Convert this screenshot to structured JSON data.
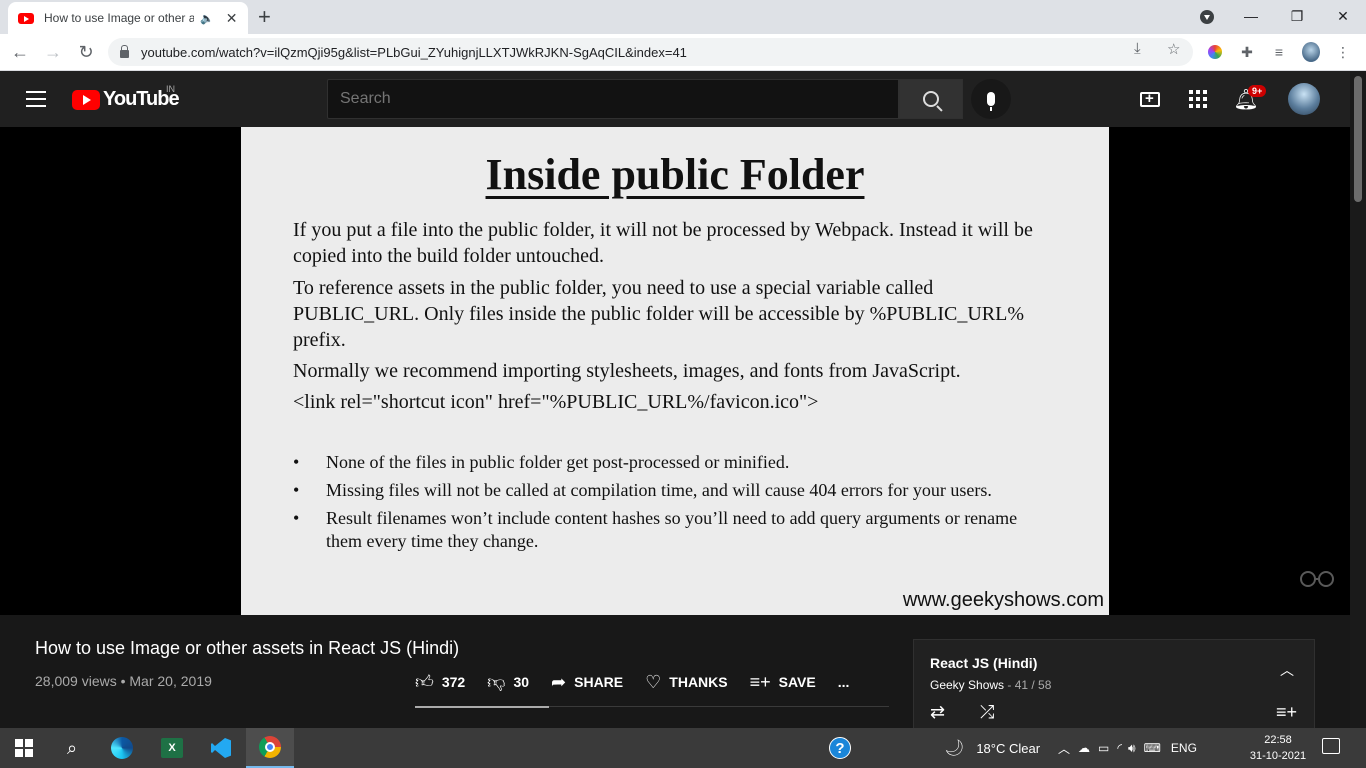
{
  "browser": {
    "tab_title": "How to use Image or other assets in React JS (Hindi) - YouTube",
    "url": "youtube.com/watch?v=ilQzmQji95g&list=PLbGui_ZYuhignjLLXTJWkRJKN-SgAqCIL&index=41"
  },
  "youtube": {
    "logo_text": "YouTube",
    "region": "IN",
    "search_placeholder": "Search",
    "notification_count": "9+"
  },
  "slide": {
    "title": "Inside public Folder",
    "paragraphs": [
      "If you put a file into the public folder, it will not be processed by Webpack. Instead it will be copied into the build folder untouched.",
      "To reference assets in the public folder, you need to use a special variable called PUBLIC_URL. Only files inside the public folder will be accessible by %PUBLIC_URL% prefix.",
      "Normally we recommend importing stylesheets, images, and fonts from JavaScript.",
      "<link rel=\"shortcut icon\" href=\"%PUBLIC_URL%/favicon.ico\">"
    ],
    "bullets": [
      "None of the files in public folder get post-processed or minified.",
      "Missing files will not be called at compilation time, and will cause 404 errors for your users.",
      "Result filenames won’t include content hashes so you’ll need to add query arguments or rename them every time they change."
    ],
    "watermark": "www.geekyshows.com"
  },
  "video": {
    "title": "How to use Image or other assets in React JS (Hindi)",
    "meta": "28,009 views • Mar 20, 2019",
    "likes": "372",
    "dislikes": "30",
    "share_label": "SHARE",
    "thanks_label": "THANKS",
    "save_label": "SAVE",
    "more_label": "..."
  },
  "playlist": {
    "title": "React JS (Hindi)",
    "channel": "Geeky Shows",
    "position": " - 41 / 58"
  },
  "taskbar": {
    "weather": "18°C  Clear",
    "language": "ENG",
    "time": "22:58",
    "date": "31-10-2021"
  },
  "colors": {
    "youtube_red": "#ff0000",
    "header_bg": "#202020",
    "page_bg": "#181818",
    "taskbar_bg": "#3a3a3a"
  }
}
